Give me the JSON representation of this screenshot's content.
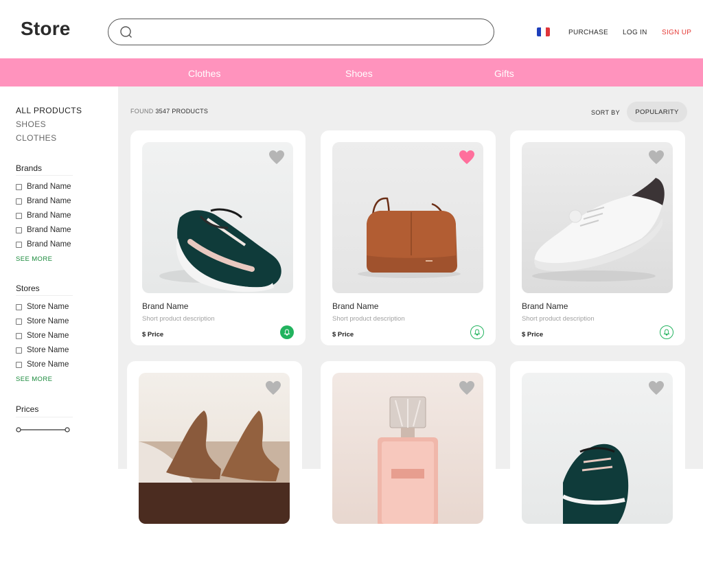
{
  "header": {
    "logo": "Store",
    "search_placeholder": "",
    "flag_colors": [
      "#1d3fbb",
      "#ffffff",
      "#e0353a"
    ],
    "links": {
      "purchase": "PURCHASE",
      "login": "LOG IN",
      "signup": "SIGN UP"
    }
  },
  "categories": [
    "Clothes",
    "Shoes",
    "Gifts"
  ],
  "sidebar": {
    "nav": [
      "ALL PRODUCTS",
      "SHOES",
      "CLOTHES"
    ],
    "brands_title": "Brands",
    "brands": [
      "Brand Name",
      "Brand Name",
      "Brand Name",
      "Brand Name",
      "Brand Name"
    ],
    "stores_title": "Stores",
    "stores": [
      "Store Name",
      "Store Name",
      "Store Name",
      "Store Name",
      "Store Name"
    ],
    "see_more": "SEE MORE",
    "prices_title": "Prices"
  },
  "results": {
    "found_prefix": "FOUND",
    "found_count": "3547 PRODUCTS",
    "sort_label": "SORT BY",
    "sort_value": "POPULARITY"
  },
  "products": [
    {
      "brand": "Brand Name",
      "description": "Short product description",
      "price": "$ Price",
      "favorite": false,
      "alert_active": true,
      "image": "green-sneaker"
    },
    {
      "brand": "Brand Name",
      "description": "Short product description",
      "price": "$ Price",
      "favorite": true,
      "alert_active": false,
      "image": "brown-handbag"
    },
    {
      "brand": "Brand Name",
      "description": "Short product description",
      "price": "$ Price",
      "favorite": false,
      "alert_active": false,
      "image": "white-sneaker"
    },
    {
      "image": "heels",
      "favorite": false
    },
    {
      "image": "perfume",
      "favorite": false
    },
    {
      "image": "green-sneaker-2",
      "favorite": false
    }
  ],
  "colors": {
    "accent_pink": "#ff93bd",
    "heart_active": "#ff6f9c",
    "heart_inactive": "#b5b5b5",
    "green": "#22b35e",
    "signup_red": "#e53935"
  }
}
